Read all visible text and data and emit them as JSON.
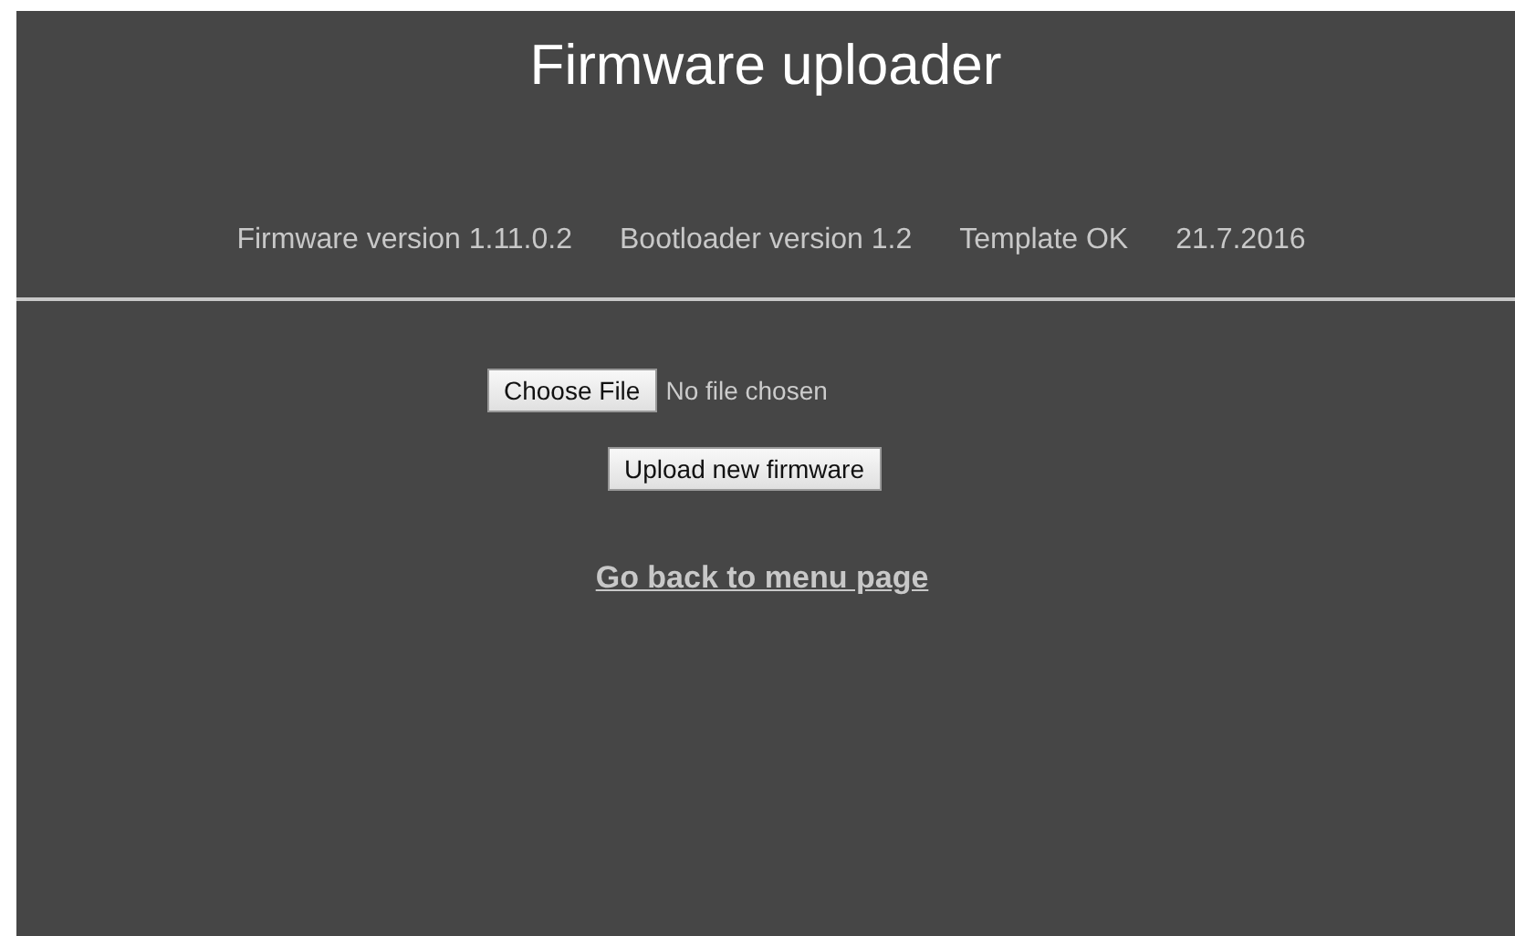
{
  "title": "Firmware uploader",
  "info": [
    "Firmware version 1.11.0.2",
    "Bootloader version 1.2",
    "Template OK",
    "21.7.2016"
  ],
  "file_input": {
    "button": "Choose File",
    "status": "No file chosen"
  },
  "upload_button": "Upload new firmware",
  "back_link": "Go back to menu page"
}
